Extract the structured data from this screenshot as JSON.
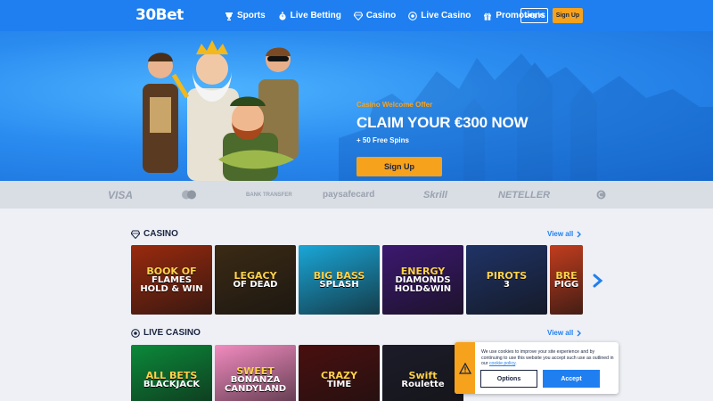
{
  "brand": {
    "logo_text": "30Bet"
  },
  "nav": {
    "items": [
      {
        "label": "Sports",
        "icon": "trophy-icon"
      },
      {
        "label": "Live Betting",
        "icon": "stopwatch-icon"
      },
      {
        "label": "Casino",
        "icon": "diamond-icon"
      },
      {
        "label": "Live Casino",
        "icon": "chip-icon"
      },
      {
        "label": "Promotions",
        "icon": "gift-icon"
      }
    ],
    "login_label": "Log in",
    "signup_label": "Sign Up"
  },
  "hero": {
    "kicker": "Casino Welcome Offer",
    "title": "CLAIM YOUR €300 NOW",
    "subtitle": "+ 50 Free Spins",
    "cta_label": "Sign Up"
  },
  "payments": [
    "VISA",
    "mastercard",
    "BANK TRANSFER",
    "paysafecard",
    "Skrill",
    "NETELLER",
    "crypto"
  ],
  "casino": {
    "title": "CASINO",
    "view_all": "View all",
    "games": [
      {
        "name_lines": [
          "BOOK OF",
          "FLAMES",
          "HOLD & WIN"
        ],
        "color": "#9a2a0e"
      },
      {
        "name_lines": [
          "LEGACY",
          "OF DEAD"
        ],
        "color": "#3b2a14"
      },
      {
        "name_lines": [
          "BIG BASS",
          "SPLASH"
        ],
        "color": "#1aa7d8"
      },
      {
        "name_lines": [
          "ENERGY",
          "DIAMONDS",
          "HOLD&WIN"
        ],
        "color": "#3c1870"
      },
      {
        "name_lines": [
          "PIROTS",
          "3"
        ],
        "color": "#1f3366"
      },
      {
        "name_lines": [
          "BRE",
          "PIGG"
        ],
        "color": "#c23d1e"
      }
    ]
  },
  "live_casino": {
    "title": "LIVE CASINO",
    "view_all": "View all",
    "games": [
      {
        "name_lines": [
          "ALL BETS",
          "BLACKJACK"
        ],
        "color": "#0b8a3a"
      },
      {
        "name_lines": [
          "SWEET",
          "BONANZA",
          "CANDYLAND"
        ],
        "color": "#f28bc0"
      },
      {
        "name_lines": [
          "CRAZY",
          "TIME"
        ],
        "color": "#4a0f0f"
      },
      {
        "name_lines": [
          "Swift",
          "Roulette"
        ],
        "color": "#1c1c2a"
      }
    ]
  },
  "cookie": {
    "message": "We use cookies to improve your site experience and by continuing to use this website you accept such use as outlined in our",
    "link_text": "cookie policy",
    "options_label": "Options",
    "accept_label": "Accept"
  }
}
